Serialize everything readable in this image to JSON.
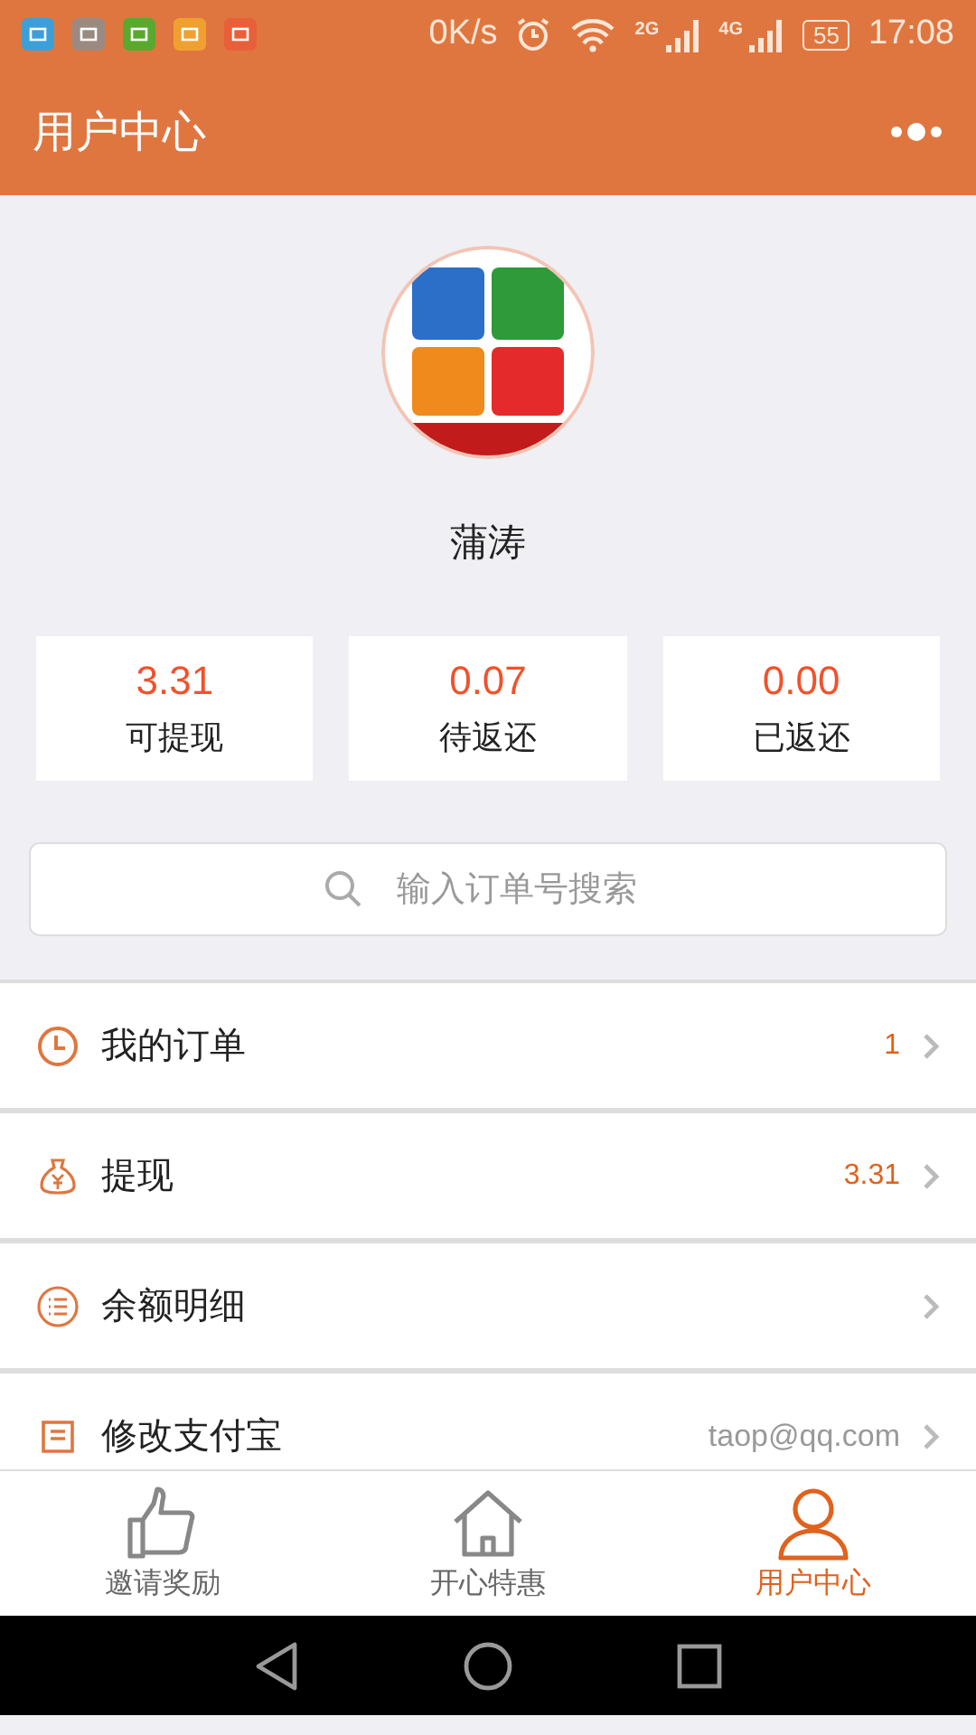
{
  "status_bar": {
    "speed": "0K/s",
    "net_a": "2G",
    "net_b": "4G",
    "battery": "55",
    "time": "17:08"
  },
  "header": {
    "title": "用户中心"
  },
  "profile": {
    "name": "蒲涛"
  },
  "stats": [
    {
      "value": "3.31",
      "label": "可提现"
    },
    {
      "value": "0.07",
      "label": "待返还"
    },
    {
      "value": "0.00",
      "label": "已返还"
    }
  ],
  "search": {
    "placeholder": "输入订单号搜索"
  },
  "menu": [
    {
      "kind": "orders",
      "label": "我的订单",
      "value": "1"
    },
    {
      "kind": "withdraw",
      "label": "提现",
      "value": "3.31"
    },
    {
      "kind": "balance",
      "label": "余额明细"
    },
    {
      "kind": "alipay",
      "label": "修改支付宝",
      "value": "taop@qq.com"
    }
  ],
  "tabs": [
    {
      "kind": "invite",
      "label": "邀请奖励",
      "selected": false
    },
    {
      "kind": "home",
      "label": "开心特惠",
      "selected": false
    },
    {
      "kind": "user",
      "label": "用户中心",
      "selected": true
    }
  ]
}
